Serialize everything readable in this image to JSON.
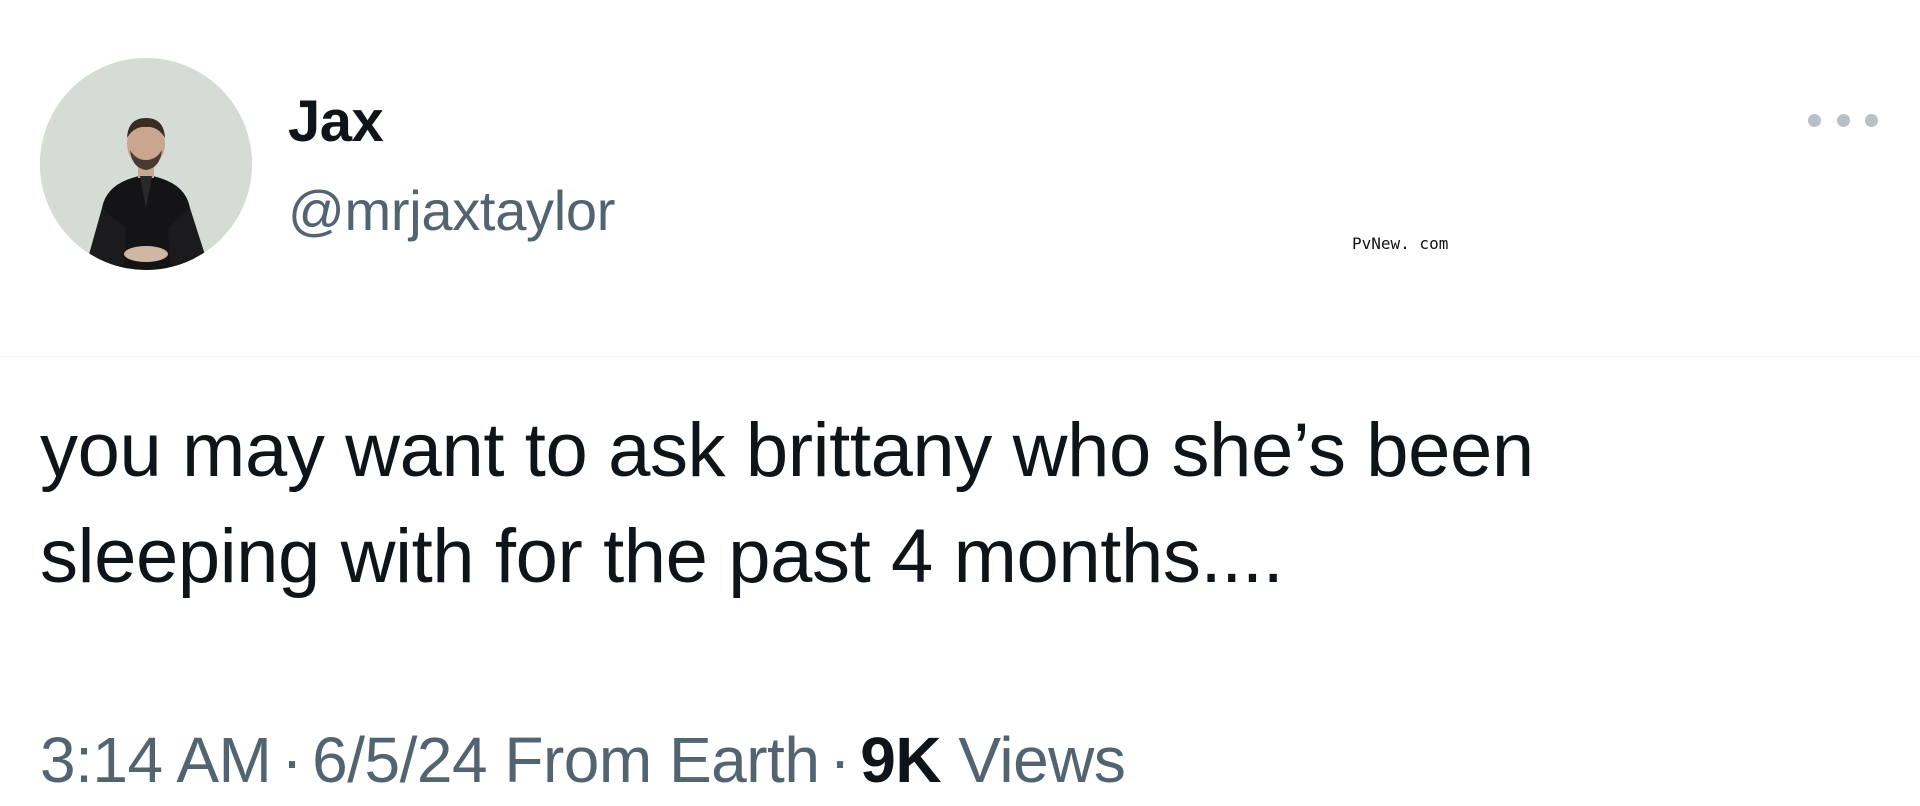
{
  "tweet": {
    "author": {
      "display_name": "Jax",
      "handle": "@mrjaxtaylor",
      "avatar_icon": "profile-photo"
    },
    "more_icon": "more-options-icon",
    "watermark": "PvNew. com",
    "text_lines": [
      "you may want to ask brittany who she’s been",
      "sleeping with for the past 4 months...."
    ],
    "meta": {
      "time": "3:14 AM",
      "separator": "·",
      "date_source": "6/5/24 From Earth",
      "views_count": "9K",
      "views_label": "Views"
    }
  }
}
